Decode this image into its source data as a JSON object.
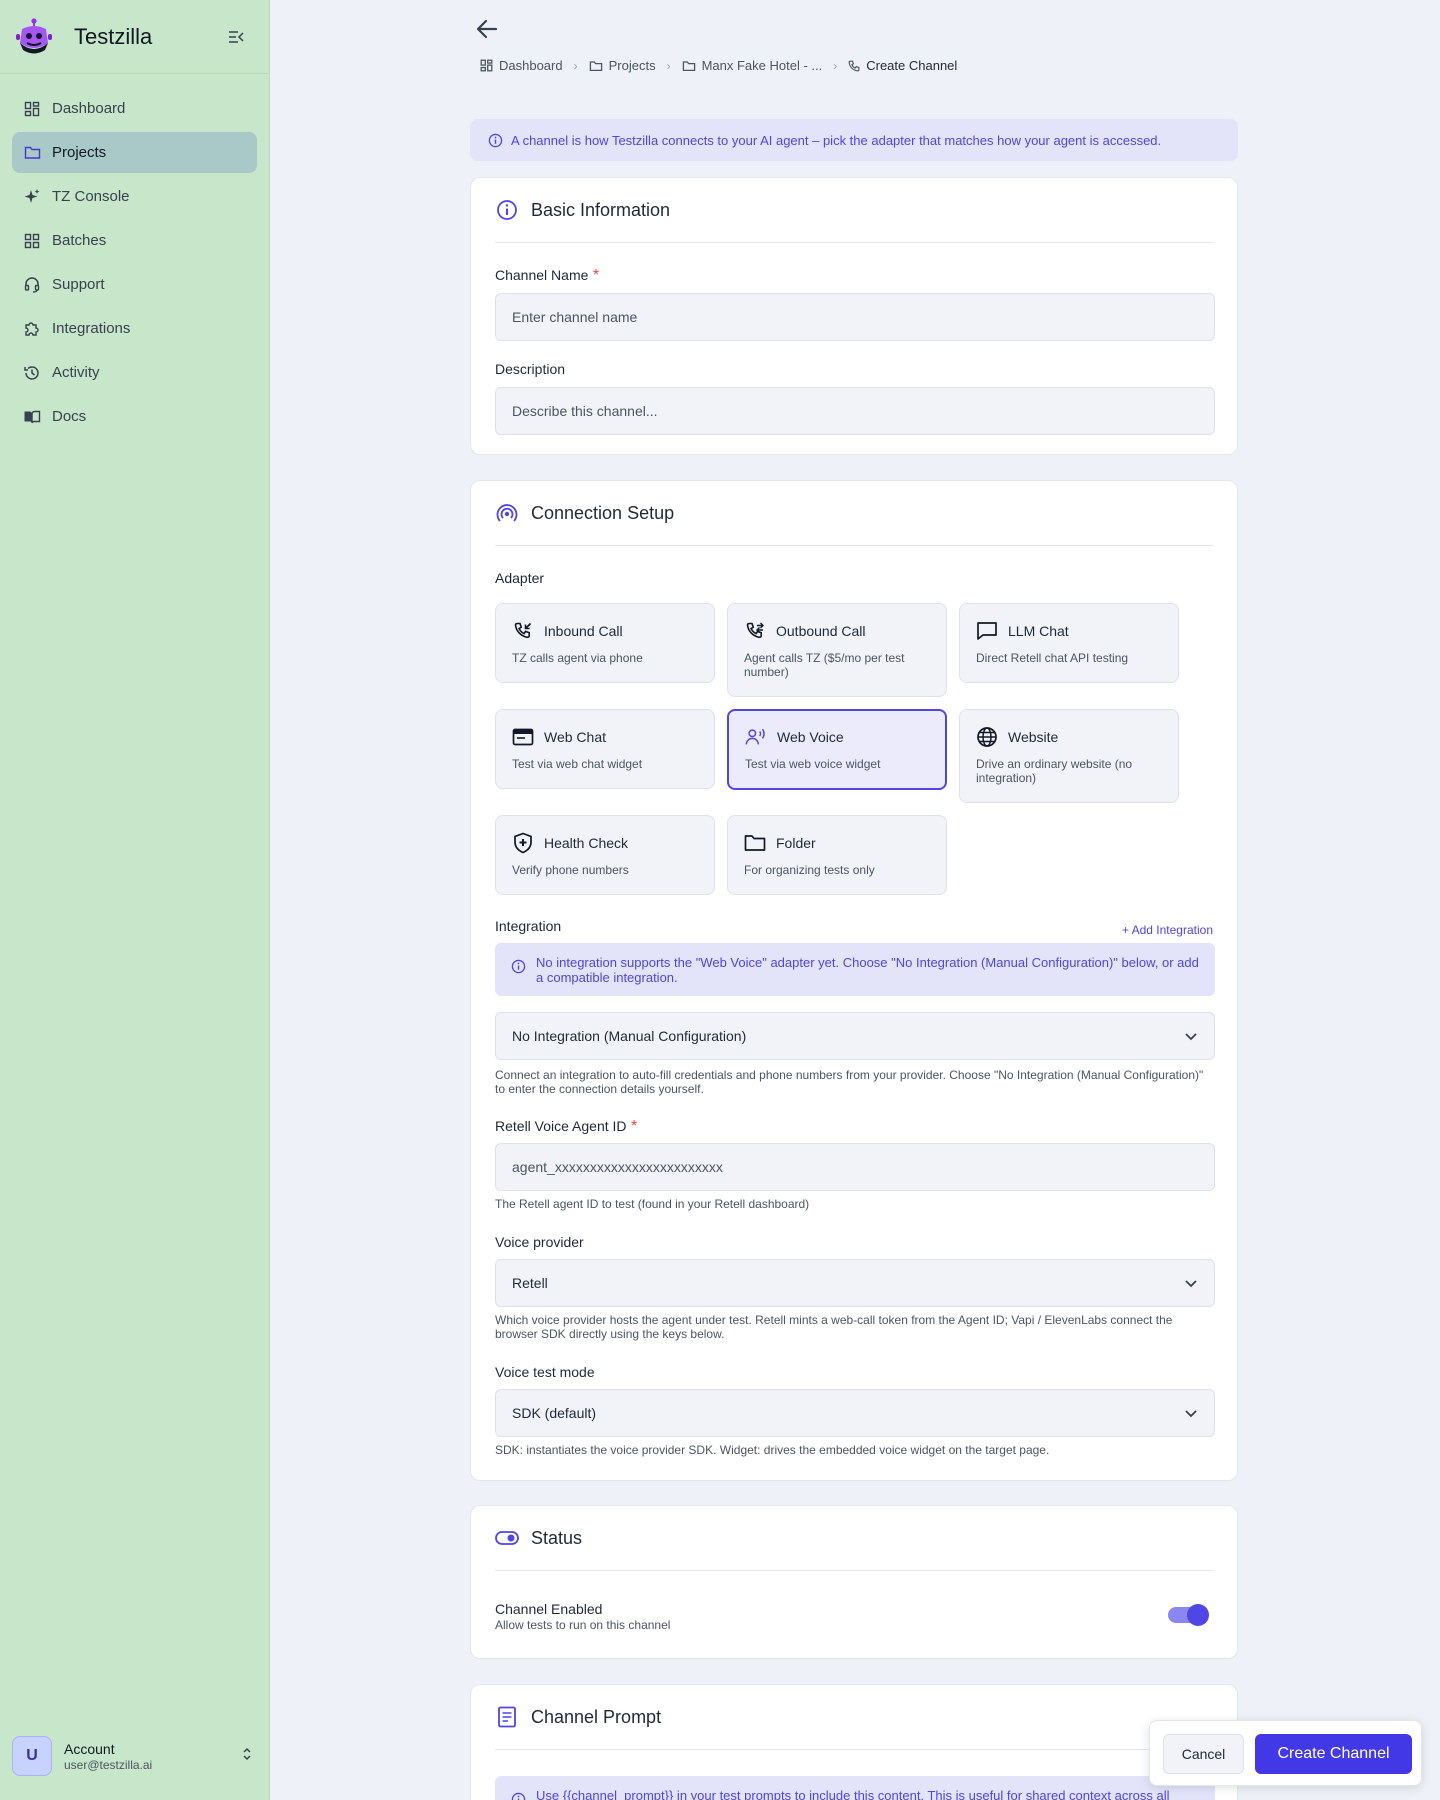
{
  "app": {
    "name": "Testzilla"
  },
  "sidebar": {
    "items": [
      {
        "label": "Dashboard",
        "icon": "dashboard-icon"
      },
      {
        "label": "Projects",
        "icon": "folder-icon",
        "active": true
      },
      {
        "label": "TZ Console",
        "icon": "sparkle-icon"
      },
      {
        "label": "Batches",
        "icon": "grid-icon"
      },
      {
        "label": "Support",
        "icon": "headset-icon"
      },
      {
        "label": "Integrations",
        "icon": "puzzle-icon"
      },
      {
        "label": "Activity",
        "icon": "history-icon"
      },
      {
        "label": "Docs",
        "icon": "book-icon"
      }
    ],
    "account": {
      "initial": "U",
      "name": "Account",
      "email": "user@testzilla.ai"
    }
  },
  "breadcrumb": [
    "Dashboard",
    "Projects",
    "Manx Fake Hotel - ...",
    "Create Channel"
  ],
  "banner": "A channel is how Testzilla connects to your AI agent – pick the adapter that matches how your agent is accessed.",
  "basic": {
    "title": "Basic Information",
    "channel_name_label": "Channel Name",
    "required_mark": "*",
    "channel_name_placeholder": "Enter channel name",
    "description_label": "Description",
    "description_placeholder": "Describe this channel..."
  },
  "connection": {
    "title": "Connection Setup",
    "adapter_label": "Adapter",
    "adapters": [
      {
        "name": "Inbound Call",
        "desc": "TZ calls agent via phone",
        "icon": "phone-incoming-icon"
      },
      {
        "name": "Outbound Call",
        "desc": "Agent calls TZ ($5/mo per test number)",
        "icon": "phone-outgoing-icon"
      },
      {
        "name": "LLM Chat",
        "desc": "Direct Retell chat API testing",
        "icon": "chat-bubble-icon"
      },
      {
        "name": "Web Chat",
        "desc": "Test via web chat widget",
        "icon": "browser-window-icon"
      },
      {
        "name": "Web Voice",
        "desc": "Test via web voice widget",
        "icon": "voice-user-icon",
        "selected": true
      },
      {
        "name": "Website",
        "desc": "Drive an ordinary website (no integration)",
        "icon": "globe-icon"
      },
      {
        "name": "Health Check",
        "desc": "Verify phone numbers",
        "icon": "shield-plus-icon"
      },
      {
        "name": "Folder",
        "desc": "For organizing tests only",
        "icon": "folder-icon"
      }
    ],
    "integration_label": "Integration",
    "add_integration": "+ Add Integration",
    "integration_notice": "No integration supports the \"Web Voice\" adapter yet. Choose \"No Integration (Manual Configuration)\" below, or add a compatible integration.",
    "integration_value": "No Integration (Manual Configuration)",
    "integration_help": "Connect an integration to auto-fill credentials and phone numbers from your provider. Choose \"No Integration (Manual Configuration)\" to enter the connection details yourself.",
    "agent_id_label": "Retell Voice Agent ID",
    "agent_id_placeholder": "agent_xxxxxxxxxxxxxxxxxxxxxxxx",
    "agent_id_help": "The Retell agent ID to test (found in your Retell dashboard)",
    "provider_label": "Voice provider",
    "provider_value": "Retell",
    "provider_help": "Which voice provider hosts the agent under test. Retell mints a web-call token from the Agent ID; Vapi / ElevenLabs connect the browser SDK directly using the keys below.",
    "mode_label": "Voice test mode",
    "mode_value": "SDK (default)",
    "mode_help": "SDK: instantiates the voice provider SDK. Widget: drives the embedded voice widget on the target page."
  },
  "status": {
    "title": "Status",
    "enabled_label": "Channel Enabled",
    "enabled_help": "Allow tests to run on this channel",
    "enabled": true
  },
  "prompt": {
    "title": "Channel Prompt",
    "notice": "Use {{channel_prompt}} in your test prompts to include this content. This is useful for shared context across all"
  },
  "actions": {
    "cancel": "Cancel",
    "create": "Create Channel"
  },
  "colors": {
    "accent": "#4f46e5",
    "sidebar_bg": "#c8e6c9",
    "page_bg": "#eef1f7"
  }
}
